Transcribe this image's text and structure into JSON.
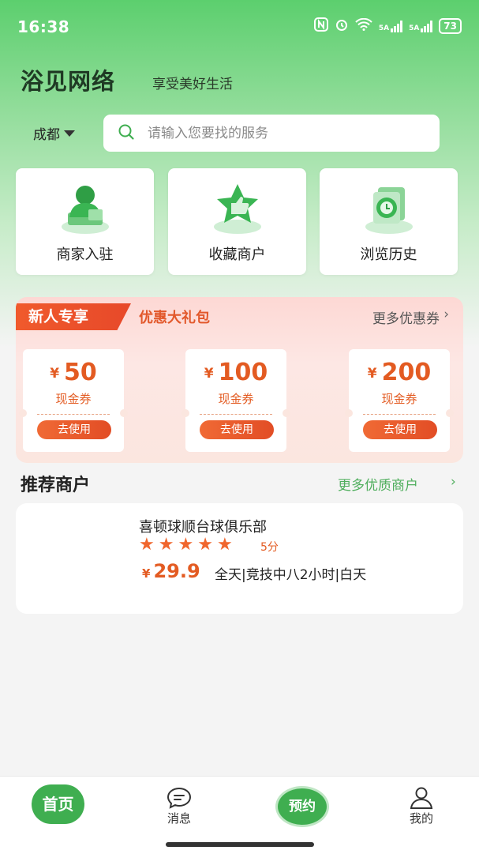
{
  "status": {
    "time": "16:38",
    "net1": "5A",
    "net2": "5A",
    "battery": "73"
  },
  "header": {
    "brand": "浴见网络",
    "slogan": "享受美好生活"
  },
  "location": {
    "city": "成都"
  },
  "search": {
    "placeholder": "请输入您要找的服务"
  },
  "features": [
    {
      "label": "商家入驻",
      "icon": "merchant-join-icon"
    },
    {
      "label": "收藏商户",
      "icon": "favorite-star-icon"
    },
    {
      "label": "浏览历史",
      "icon": "history-clock-icon"
    }
  ],
  "promo": {
    "tag": "新人专享",
    "subtitle": "优惠大礼包",
    "more": "更多优惠券",
    "coupons": [
      {
        "currency": "¥",
        "amount": "50",
        "kind": "现金券",
        "action": "去使用"
      },
      {
        "currency": "¥",
        "amount": "100",
        "kind": "现金券",
        "action": "去使用"
      },
      {
        "currency": "¥",
        "amount": "200",
        "kind": "现金券",
        "action": "去使用"
      }
    ]
  },
  "recommend": {
    "title": "推荐商户",
    "more": "更多优质商户",
    "items": [
      {
        "name": "喜顿球顺台球俱乐部",
        "rating": 5,
        "score": "5分",
        "currency": "¥",
        "price": "29.9",
        "desc": "全天|竞技中八2小时|白天"
      }
    ]
  },
  "tabbar": {
    "home": "首页",
    "messages": "消息",
    "book": "预约",
    "mine": "我的"
  },
  "colors": {
    "brand_green": "#3fae50",
    "accent_orange": "#e35b22"
  }
}
